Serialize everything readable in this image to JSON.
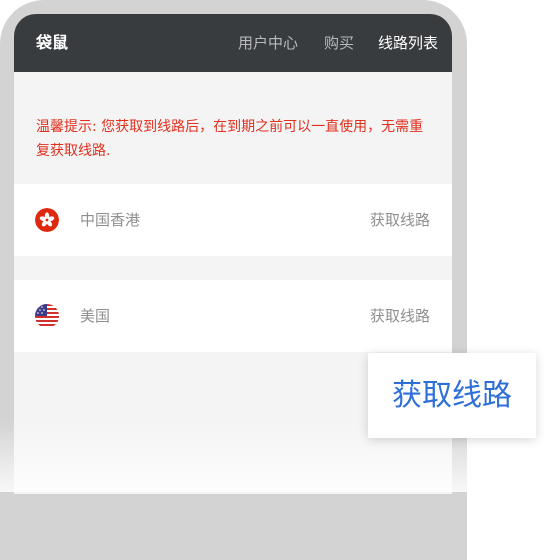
{
  "navbar": {
    "brand": "袋鼠",
    "links": [
      "用户中心",
      "购买",
      "线路列表"
    ]
  },
  "notice": {
    "text": "温馨提示: 您获取到线路后，在到期之前可以一直使用，无需重复获取线路."
  },
  "routes": [
    {
      "region": "中国香港",
      "flag_icon": "hong-kong-flag-icon",
      "action": "获取线路"
    },
    {
      "region": "美国",
      "flag_icon": "us-flag-icon",
      "action": "获取线路"
    }
  ],
  "callout": {
    "label": "获取线路"
  },
  "colors": {
    "navbar": "#393c3f",
    "notice_text": "#e0301e",
    "callout_text": "#2f6fd9",
    "page_background": "#f4f4f4",
    "hong_kong_flag": "#de2910",
    "us_flag_red": "#d22f2f",
    "us_flag_blue": "#3c3b8a"
  }
}
